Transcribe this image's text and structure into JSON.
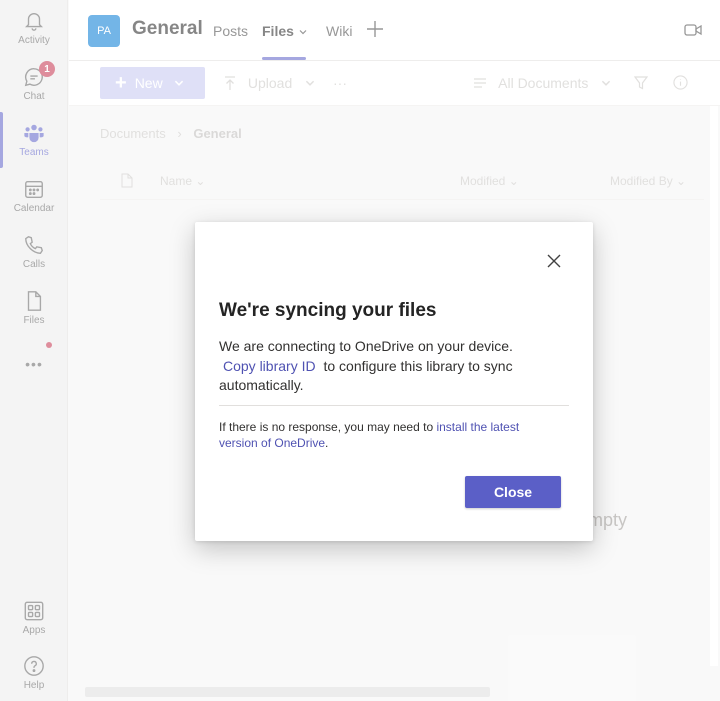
{
  "rail": {
    "items": [
      {
        "label": "Activity",
        "icon": "bell-icon"
      },
      {
        "label": "Chat",
        "icon": "chat-icon",
        "badge": "1"
      },
      {
        "label": "Teams",
        "icon": "teams-icon"
      },
      {
        "label": "Calendar",
        "icon": "calendar-icon"
      },
      {
        "label": "Calls",
        "icon": "phone-icon"
      },
      {
        "label": "Files",
        "icon": "file-icon"
      },
      {
        "label": "Apps",
        "icon": "apps-icon"
      },
      {
        "label": "Help",
        "icon": "help-icon"
      }
    ],
    "more": "•••"
  },
  "header": {
    "avatar": "PA",
    "title": "General",
    "tabs": [
      "Posts",
      "Files",
      "Wiki"
    ]
  },
  "toolbar": {
    "new_label": "New",
    "upload_label": "Upload",
    "more": "···",
    "view_label": "All Documents"
  },
  "breadcrumb": {
    "root": "Documents",
    "current": "General"
  },
  "columns": [
    "Name",
    "Modified",
    "Modified By"
  ],
  "empty_text": "mpty",
  "dialog": {
    "title": "We're syncing your files",
    "body_pre": "We are connecting to OneDrive on your device.",
    "body_link": "Copy library ID",
    "body_post": "to configure this library to sync automatically.",
    "note_pre": "If there is no response, you may need to",
    "note_link": "install the latest version of OneDrive",
    "note_post": ".",
    "close_label": "Close"
  },
  "colors": {
    "accent": "#5b5fc7",
    "badge": "#c4314b",
    "avatar": "#0078d4"
  }
}
